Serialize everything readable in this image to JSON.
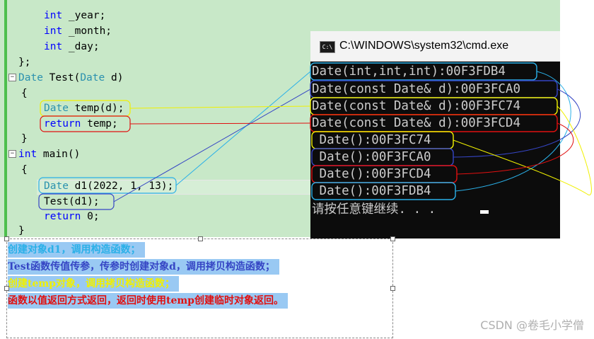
{
  "editor": {
    "lines": [
      {
        "text": "int _year;"
      },
      {
        "text": "int _month;"
      },
      {
        "text": "int _day;"
      },
      {
        "text": "};"
      },
      {
        "text": "Date Test(Date d)"
      },
      {
        "text": "{"
      },
      {
        "text": "Date temp(d);"
      },
      {
        "text": "return temp;"
      },
      {
        "text": "}"
      },
      {
        "text": "int main()"
      },
      {
        "text": "{"
      },
      {
        "text": "Date d1(2022, 1, 13);"
      },
      {
        "text": "Test(d1);"
      },
      {
        "text": "return 0;"
      },
      {
        "text": "}"
      }
    ],
    "fold_symbol": "−",
    "colors": {
      "keyword": "#0000ff",
      "type": "#2b91af",
      "background": "#c8e8c8"
    }
  },
  "console": {
    "title": "C:\\WINDOWS\\system32\\cmd.exe",
    "icon": "cmd-icon",
    "icon_text": "C:\\",
    "lines": [
      "Date(int,int,int):00F3FDB4",
      "Date(const Date& d):00F3FCA0",
      "Date(const Date& d):00F3FC74",
      "Date(const Date& d):00F3FCD4",
      " Date():00F3FC74",
      " Date():00F3FCA0",
      " Date():00F3FCD4",
      " Date():00F3FDB4",
      "请按任意键继续. . ."
    ]
  },
  "notes": {
    "lines": [
      {
        "text": "创建对象d1，调用构造函数；",
        "color": "#2ab0e8"
      },
      {
        "text": "Test函数传值传参，传参时创建对象d，调用拷贝构造函数；",
        "color": "#3545c4"
      },
      {
        "text": "创建temp对象，调用拷贝构造函数；",
        "color": "#f0f000"
      },
      {
        "text": "函数以值返回方式返回，返回时使用temp创建临时对象返回。",
        "color": "#e01010"
      }
    ]
  },
  "watermark": "CSDN @卷毛小学僧"
}
